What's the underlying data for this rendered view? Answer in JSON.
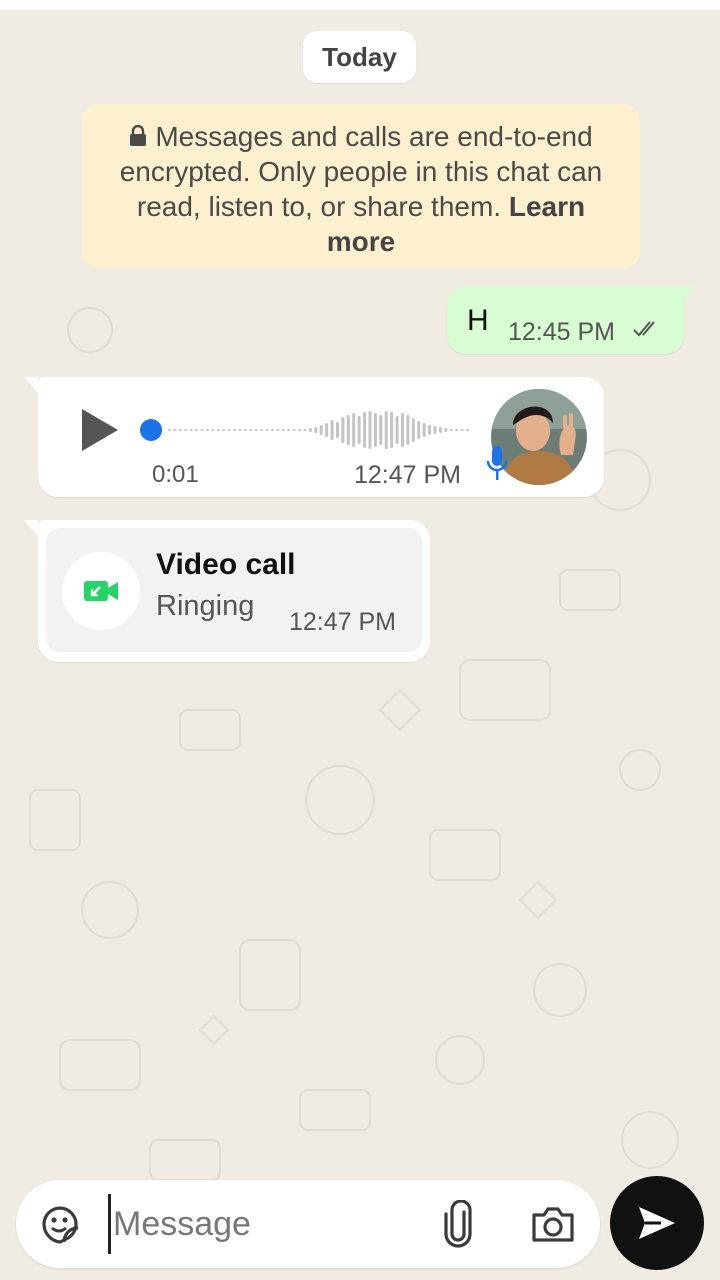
{
  "chat": {
    "date_divider": "Today",
    "encryption_notice": {
      "text": "Messages and calls are end-to-end encrypted. Only people in this chat can read, listen to, or share them.",
      "link": "Learn more"
    },
    "messages": [
      {
        "direction": "outgoing",
        "type": "text",
        "text": "H",
        "time": "12:45 PM",
        "status": "read"
      },
      {
        "direction": "incoming",
        "type": "voice",
        "duration": "0:01",
        "time": "12:47 PM",
        "progress": 0
      },
      {
        "direction": "incoming",
        "type": "call",
        "title": "Video call",
        "status": "Ringing",
        "time": "12:47 PM"
      }
    ]
  },
  "composer": {
    "placeholder": "Message",
    "value": ""
  },
  "icons": {
    "lock": "lock-icon",
    "read_ticks": "double-check-icon",
    "play": "play-icon",
    "mic": "mic-icon",
    "video_call": "video-call-missed-icon",
    "sticker": "sticker-icon",
    "attach": "paperclip-icon",
    "camera": "camera-icon",
    "send": "send-icon"
  },
  "colors": {
    "outgoing_bubble": "#d8fdd2",
    "incoming_bubble": "#ffffff",
    "notice_bg": "#fdf0cf",
    "accent_blue": "#1a73e8",
    "call_green": "#25d366",
    "wallpaper": "#f0ece4"
  }
}
